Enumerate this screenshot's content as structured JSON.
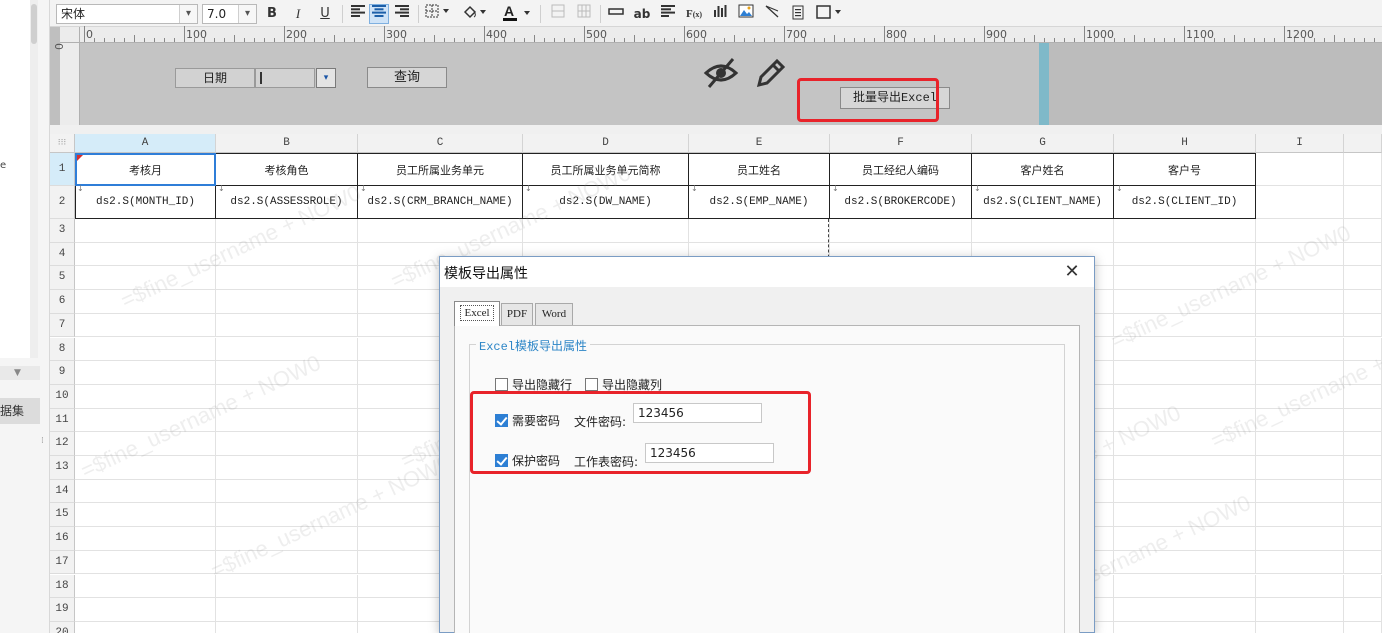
{
  "toolbar": {
    "font_name": "宋体",
    "font_size": "7.0",
    "text_letters": "ab"
  },
  "param_panel": {
    "ruler_labels": [
      "0",
      "100",
      "200",
      "300",
      "400",
      "500",
      "600",
      "700",
      "800",
      "900",
      "1000",
      "1100",
      "1200"
    ],
    "ruler_vertical": "0",
    "date_label": "日期",
    "query_button": "查询",
    "export_button": "批量导出Excel"
  },
  "sidebar": {
    "fragment_e": "e",
    "dataset_tab": "据集"
  },
  "grid": {
    "columns": [
      "A",
      "B",
      "C",
      "D",
      "E",
      "F",
      "G",
      "H",
      "I"
    ],
    "rows": [
      "1",
      "2",
      "3",
      "4",
      "5",
      "6",
      "7",
      "8",
      "9",
      "10",
      "11",
      "12",
      "13",
      "14",
      "15",
      "16",
      "17",
      "18",
      "19",
      "20"
    ],
    "headers": [
      "考核月",
      "考核角色",
      "员工所属业务单元",
      "员工所属业务单元简称",
      "员工姓名",
      "员工经纪人编码",
      "客户姓名",
      "客户号"
    ],
    "bindings": [
      "ds2.S(MONTH_ID)",
      "ds2.S(ASSESSROLE)",
      "ds2.S(CRM_BRANCH_NAME)",
      "ds2.S(DW_NAME)",
      "ds2.S(EMP_NAME)",
      "ds2.S(BROKERCODE)",
      "ds2.S(CLIENT_NAME)",
      "ds2.S(CLIENT_ID)"
    ],
    "watermark": "=$fine_username + NOW0"
  },
  "dialog": {
    "title": "模板导出属性",
    "tabs": [
      "Excel",
      "PDF",
      "Word"
    ],
    "group_title": "Excel模板导出属性",
    "export_hidden_rows": "导出隐藏行",
    "export_hidden_cols": "导出隐藏列",
    "need_password": "需要密码",
    "file_password_label": "文件密码:",
    "file_password_value": "123456",
    "protect_password": "保护密码",
    "sheet_password_label": "工作表密码:",
    "sheet_password_value": "123456"
  },
  "colors": {
    "accent": "#2d7fd4",
    "highlight_red": "#e8232a"
  }
}
